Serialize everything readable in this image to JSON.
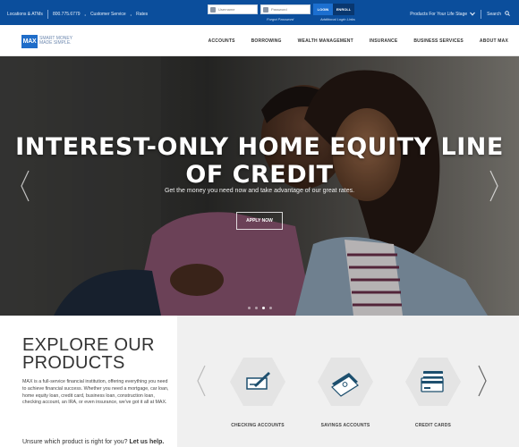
{
  "topbar": {
    "locations": "Locations & ATMs",
    "phone": "800.775.6779",
    "customer_service": "Customer Service",
    "rates": "Rates",
    "username_placeholder": "Username",
    "password_placeholder": "Password",
    "login_label": "LOGIN",
    "enroll_label": "ENROLL",
    "forgot_password": "Forgot Password",
    "additional_login_links": "Additional Login Links",
    "life_stage": "Products For Your Life Stage",
    "search": "Search"
  },
  "nav": {
    "logo": "MAX",
    "tagline_line1": "SMART MONEY",
    "tagline_line2": "MADE SIMPLE.",
    "items": [
      "ACCOUNTS",
      "BORROWING",
      "WEALTH MANAGEMENT",
      "INSURANCE",
      "BUSINESS SERVICES",
      "ABOUT MAX"
    ]
  },
  "hero": {
    "title_line1": "INTEREST-ONLY HOME EQUITY LINE",
    "title_line2": "OF CREDIT",
    "subtitle": "Get the money you need now and take advantage of our great rates.",
    "cta": "APPLY NOW",
    "slide_count": 4,
    "active_slide": 3
  },
  "explore": {
    "heading_line1": "EXPLORE OUR",
    "heading_line2": "PRODUCTS",
    "body": "MAX is a full-service financial institution, offering everything you need to achieve financial success. Whether you need a mortgage, car loan, home equity loan, credit card, business loan, construction loan, checking account, an IRA, or even insurance, we've got it all at MAX.",
    "unsure": "Unsure which product is right for you?",
    "unsure_link": "Let us help."
  },
  "products": {
    "items": [
      {
        "label": "CHECKING ACCOUNTS",
        "icon": "check-pen-icon"
      },
      {
        "label": "SAVINGS ACCOUNTS",
        "icon": "cash-stack-icon"
      },
      {
        "label": "CREDIT CARDS",
        "icon": "credit-card-icon"
      }
    ]
  },
  "colors": {
    "brand_blue": "#0b4e9c",
    "logo_blue": "#1f6dc9",
    "icon_teal": "#1d4f6e"
  }
}
